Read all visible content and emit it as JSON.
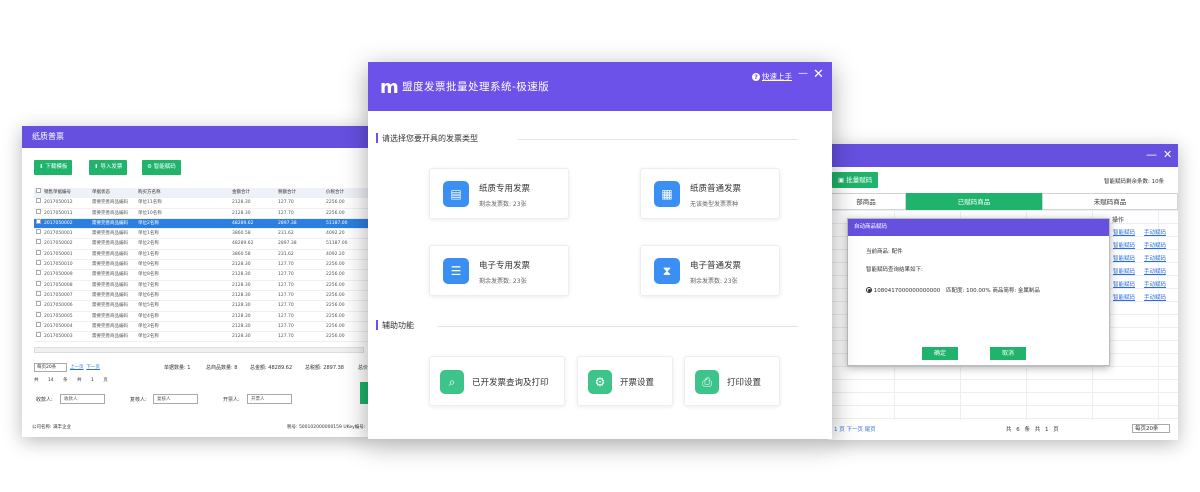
{
  "left_window": {
    "title": "纸质普票",
    "buttons": {
      "download": "下载模板",
      "import": "导入发票",
      "smart": "智能赋码"
    },
    "columns": [
      "销售单据编号",
      "单据状态",
      "购买方名称",
      "金额合计",
      "税额合计",
      "价税合计"
    ],
    "rows": [
      [
        "2017050012",
        "需要完善商品编码",
        "单位11名称",
        "2128.30",
        "127.70",
        "2256.00"
      ],
      [
        "2017050011",
        "需要完善商品编码",
        "单位10名称",
        "2128.30",
        "127.70",
        "2256.00"
      ],
      [
        "2017050002",
        "需要完善商品编码",
        "单位2名称",
        "48289.62",
        "2897.38",
        "51187.00"
      ],
      [
        "2017050001",
        "需要完善商品编码",
        "单位1名称",
        "3860.58",
        "231.62",
        "4092.20"
      ],
      [
        "2017050002",
        "需要完善商品编码",
        "单位2名称",
        "48289.62",
        "2897.38",
        "51187.00"
      ],
      [
        "2017050001",
        "需要完善商品编码",
        "单位1名称",
        "3860.58",
        "231.62",
        "4092.20"
      ],
      [
        "2017050010",
        "需要完善商品编码",
        "单位9名称",
        "2128.30",
        "127.70",
        "2256.00"
      ],
      [
        "2017050009",
        "需要完善商品编码",
        "单位8名称",
        "2128.30",
        "127.70",
        "2256.00"
      ],
      [
        "2017050008",
        "需要完善商品编码",
        "单位7名称",
        "2128.30",
        "127.70",
        "2256.00"
      ],
      [
        "2017050007",
        "需要完善商品编码",
        "单位6名称",
        "2128.30",
        "127.70",
        "2256.00"
      ],
      [
        "2017050006",
        "需要完善商品编码",
        "单位5名称",
        "2128.30",
        "127.70",
        "2256.00"
      ],
      [
        "2017050005",
        "需要完善商品编码",
        "单位4名称",
        "2128.30",
        "127.70",
        "2256.00"
      ],
      [
        "2017050004",
        "需要完善商品编码",
        "单位3名称",
        "2128.30",
        "127.70",
        "2256.00"
      ],
      [
        "2017050003",
        "需要完善商品编码",
        "单位2名称",
        "2128.30",
        "127.70",
        "2256.00"
      ]
    ],
    "selected_row": 2,
    "stats": {
      "count": "单据数量: 1",
      "goods": "总商品数量: 8",
      "amount": "总金额: 48289.62",
      "tax": "总税额: 2897.38",
      "more": "总价"
    },
    "page_size": "每页20条",
    "prev": "上一页",
    "next": "下一页",
    "pager": "共 14 条 共 1 页",
    "payee_label": "收款人:",
    "payee_value": "收款人",
    "checker_label": "复核人:",
    "checker_value": "复核人",
    "drawer_label": "开票人:",
    "drawer_value": "开票人",
    "company": "公司名称: 满丰企业",
    "tax_no": "税号: 500102000000159  UKey编号:"
  },
  "center_window": {
    "logo": "m",
    "title": "盟度发票批量处理系统-极速版",
    "help": "快速上手",
    "close": "✕",
    "minimize": "—",
    "section1": "请选择您要开具的发票类型",
    "cards": [
      {
        "title": "纸质专用发票",
        "sub": "剩余发票数: 23张",
        "icon": "invoice-special-icon"
      },
      {
        "title": "纸质普通发票",
        "sub": "无该类型发票票种",
        "icon": "invoice-normal-icon"
      },
      {
        "title": "电子专用发票",
        "sub": "剩余发票数: 23张",
        "icon": "e-invoice-special-icon"
      },
      {
        "title": "电子普通发票",
        "sub": "剩余发票数: 23张",
        "icon": "e-invoice-normal-icon"
      }
    ],
    "section2": "辅助功能",
    "functions": [
      {
        "title": "已开发票查询及打印",
        "icon": "query-print-icon"
      },
      {
        "title": "开票设置",
        "icon": "invoice-settings-icon"
      },
      {
        "title": "打印设置",
        "icon": "printer-icon"
      }
    ]
  },
  "right_window": {
    "batch_button": "批量赋码",
    "remaining": "智能赋码剩余条数: 10条",
    "tabs": [
      "部商品",
      "已赋码商品",
      "未赋码商品"
    ],
    "op_header": "操作",
    "op_smart": "智能赋码",
    "op_manual": "手动赋码",
    "dialog": {
      "title": "自动商品赋码",
      "current": "当前商品: 配件",
      "result": "智能赋码查询结果如下:",
      "option": "1080417000000000000",
      "match": "匹配度: 100.00% 商品简称: 金属制品",
      "ok": "确定",
      "cancel": "取消"
    },
    "pager_left": "1    页  下一页  尾页",
    "pager_right": "共    6    条    共    1    页",
    "page_size": "每页20条"
  },
  "colors": {
    "purple": "#6c52e9",
    "green": "#1fb36b",
    "blue": "#3b8ff3",
    "teal": "#3cc48b"
  }
}
